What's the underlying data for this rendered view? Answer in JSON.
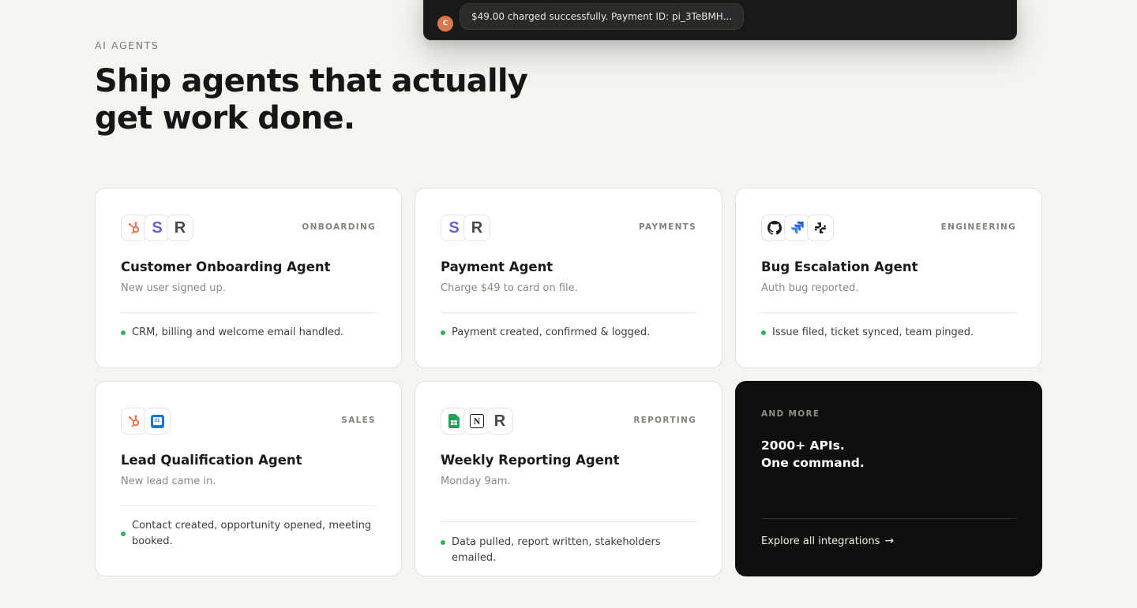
{
  "chat": {
    "avatar_letter": "C",
    "message": "$49.00 charged successfully. Payment ID: pi_3TeBMH..."
  },
  "section": {
    "eyebrow": "AI AGENTS",
    "headline": "Ship agents that actually get work done."
  },
  "cards": [
    {
      "tag": "ONBOARDING",
      "title": "Customer Onboarding Agent",
      "trigger": "New user signed up.",
      "result": "CRM, billing and welcome email handled.",
      "icons": [
        "hubspot-icon",
        "stripe-icon",
        "r-icon"
      ]
    },
    {
      "tag": "PAYMENTS",
      "title": "Payment Agent",
      "trigger": "Charge $49 to card on file.",
      "result": "Payment created, confirmed & logged.",
      "icons": [
        "stripe-icon",
        "r-icon"
      ]
    },
    {
      "tag": "ENGINEERING",
      "title": "Bug Escalation Agent",
      "trigger": "Auth bug reported.",
      "result": "Issue filed, ticket synced, team pinged.",
      "icons": [
        "github-icon",
        "jira-icon",
        "slack-icon"
      ]
    },
    {
      "tag": "SALES",
      "title": "Lead Qualification Agent",
      "trigger": "New lead came in.",
      "result": "Contact created, opportunity opened, meeting booked.",
      "icons": [
        "hubspot-icon",
        "google-calendar-icon"
      ]
    },
    {
      "tag": "REPORTING",
      "title": "Weekly Reporting Agent",
      "trigger": "Monday 9am.",
      "result": "Data pulled, report written, stakeholders emailed.",
      "icons": [
        "google-sheets-icon",
        "notion-icon",
        "r-icon"
      ]
    }
  ],
  "more": {
    "eyebrow": "AND MORE",
    "line1": "2000+ APIs.",
    "line2": "One command.",
    "link": "Explore all integrations",
    "arrow": "→"
  },
  "icon_glyphs": {
    "stripe": "S",
    "r": "R",
    "calendar_day": "31",
    "notion": "N"
  },
  "colors": {
    "hubspot": "#e8744d",
    "stripe": "#5f63d6",
    "jira": "#2563d9",
    "gcal": "#1a73e8",
    "sheets": "#22a35a",
    "status_dot": "#2fb158"
  }
}
